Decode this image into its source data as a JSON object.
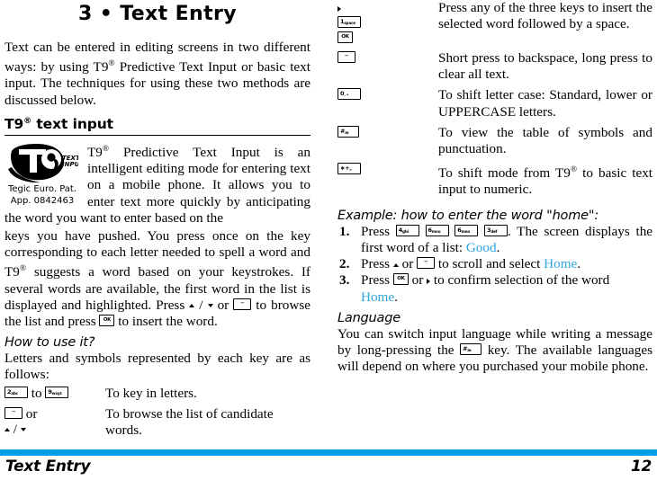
{
  "chapter": {
    "title": "3 • Text Entry"
  },
  "intro": {
    "paragraph": "Text can be entered in editing screens in two different ways: by using T9® Predictive Text Input or basic text input. The techniques for using these two methods are discussed below."
  },
  "t9_section": {
    "heading": "T9® text input",
    "logo": {
      "mark": "T9",
      "mark_sub_line1": "TEXT",
      "mark_sub_line2": "INPUT",
      "caption_line1": "Tegic Euro. Pat.",
      "caption_line2": "App. 0842463"
    },
    "paragraph_part1": "T9® Predictive Text Input is an intelligent editing mode for entering text on a mobile phone. It allows you to enter text more quickly by anticipating the word you want to enter based on the",
    "paragraph_part2": "keys you have pushed. You press once on the key corresponding to each letter needed to spell a word and T9® suggests a word based on your keystrokes. If several words are available, the first word in the list is displayed and highlighted. Press ",
    "paragraph_part3": " / ",
    "paragraph_part4": " or ",
    "paragraph_part5": " to browse the list and press ",
    "paragraph_part6": " to insert the word."
  },
  "how_to_use": {
    "heading": "How to use it?",
    "intro": "Letters and symbols represented by each key are as follows:",
    "rows": [
      {
        "key_label_1": "2",
        "key_sub_1": "abc",
        "joiner": "to",
        "key_label_2": "9",
        "key_sub_2": "wxyz",
        "description": "To key in letters."
      },
      {
        "key_backspace": "–",
        "joiner": "or",
        "arrow_up": "▴",
        "arrow_slash": "/",
        "arrow_down": "▾",
        "description": "To browse the list of candidate words."
      }
    ]
  },
  "right_keys": {
    "rows": [
      {
        "keys": [
          {
            "type": "arrow-right",
            "label": "▸"
          },
          {
            "type": "num",
            "label": "1",
            "sub": "space"
          },
          {
            "type": "ok",
            "label": "OK"
          }
        ],
        "description": "Press any of the three keys to insert the selected word followed by a space."
      },
      {
        "keys": [
          {
            "type": "backspace",
            "label": "–"
          }
        ],
        "description": "Short press to backspace, long press to clear all text."
      },
      {
        "keys": [
          {
            "type": "zero",
            "label": "0",
            "sub": "."
          }
        ],
        "description": "To shift letter case: Standard, lower or UPPERCASE letters."
      },
      {
        "keys": [
          {
            "type": "hash",
            "label": "#",
            "sub": "æ"
          }
        ],
        "description": "To view the table of symbols and punctuation."
      },
      {
        "keys": [
          {
            "type": "star",
            "label": "∗+",
            "sub": "»"
          }
        ],
        "description": "To shift mode from T9® to basic text input to numeric."
      }
    ]
  },
  "example": {
    "heading": "Example: how to enter the word \"home\":",
    "step1": {
      "press": "Press",
      "keys": [
        {
          "label": "4",
          "sub": "ghi"
        },
        {
          "label": "6",
          "sub": "mno"
        },
        {
          "label": "6",
          "sub": "mno"
        },
        {
          "label": "3",
          "sub": "def"
        }
      ],
      "text_after": ". The screen displays the first word of a list: ",
      "highlight": "Good",
      "period": "."
    },
    "step2": {
      "text_before": "Press ",
      "arrow_up": "▴",
      "text_mid": " or ",
      "key_backspace": "–",
      "text_after": " to scroll and select ",
      "highlight": "Home",
      "period": "."
    },
    "step3": {
      "text_before": "Press ",
      "key_ok": "OK",
      "text_mid": " or ",
      "arrow_right": "▸",
      "text_after": " to confirm selection of the word ",
      "highlight": "Home",
      "period": "."
    }
  },
  "language": {
    "heading": "Language",
    "text_part1": "You can switch input language while writing a message by long-pressing the ",
    "key_label": "#",
    "key_sub": "æ",
    "text_part2": " key. The available languages will depend on where you purchased your mobile phone."
  },
  "footer": {
    "section": "Text Entry",
    "page": "12",
    "bar_color": "#00A0E9"
  }
}
